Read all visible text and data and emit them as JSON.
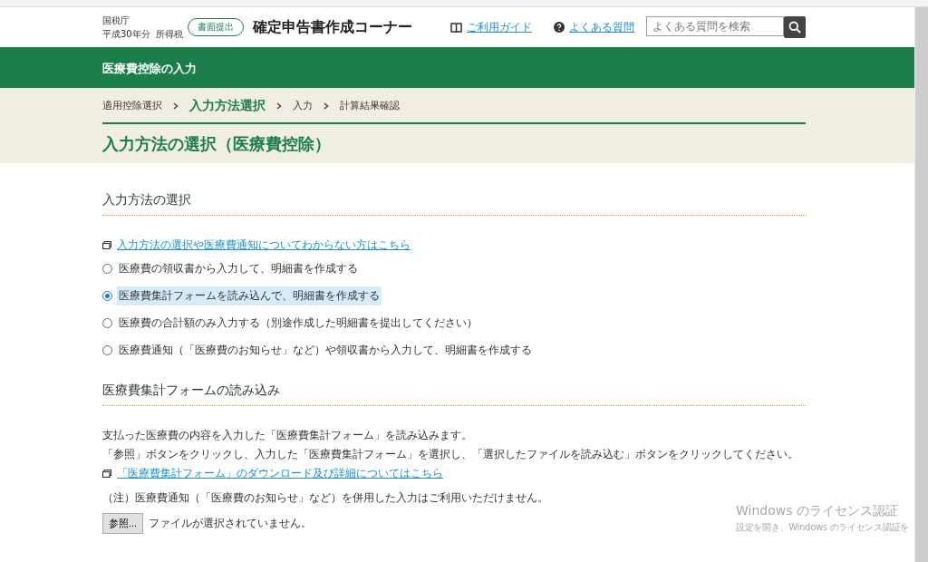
{
  "header": {
    "agency": "国税庁",
    "year": "平成30年分",
    "tax": "所得税",
    "badge": "書面提出",
    "title": "確定申告書作成コーナー",
    "links": [
      {
        "label": "ご利用ガイド",
        "kind": "guide"
      },
      {
        "label": "よくある質問",
        "kind": "faq"
      }
    ],
    "search": {
      "placeholder": "よくある質問を検索"
    }
  },
  "section_bar": {
    "title": "医療費控除の入力"
  },
  "steps": [
    {
      "label": "適用控除選択",
      "selected": false
    },
    {
      "label": "入力方法選択",
      "selected": true
    },
    {
      "label": "入力",
      "selected": false
    },
    {
      "label": "計算結果確認",
      "selected": false
    }
  ],
  "page_title": "入力方法の選択（医療費控除）",
  "method_section": {
    "heading": "入力方法の選択",
    "help_link": "入力方法の選択や医療費通知についてわからない方はこちら",
    "options": [
      {
        "label": "医療費の領収書から入力して、明細書を作成する",
        "selected": false
      },
      {
        "label": "医療費集計フォームを読み込んで、明細書を作成する",
        "selected": true
      },
      {
        "label": "医療費の合計額のみ入力する（別途作成した明細書を提出してください）",
        "selected": false
      },
      {
        "label": "医療費通知（「医療費のお知らせ」など）や領収書から入力して、明細書を作成する",
        "selected": false
      }
    ]
  },
  "import_section": {
    "heading": "医療費集計フォームの読み込み",
    "paragraphs": [
      "支払った医療費の内容を入力した「医療費集計フォーム」を読み込みます。",
      "「参照」ボタンをクリックし、入力した「医療費集計フォーム」を選択し、「選択したファイルを読み込む」ボタンをクリックしてください。"
    ],
    "download_link": "「医療費集計フォーム」のダウンロード及び詳細についてはこちら",
    "note": "（注）医療費通知（「医療費のお知らせ」など）を併用した入力はご利用いただけません。",
    "browse_button": "参照...",
    "file_status": "ファイルが選択されていません。"
  },
  "watermark": {
    "title": "Windows のライセンス認証",
    "text": "設定を開き、Windows のライセンス認証を"
  }
}
